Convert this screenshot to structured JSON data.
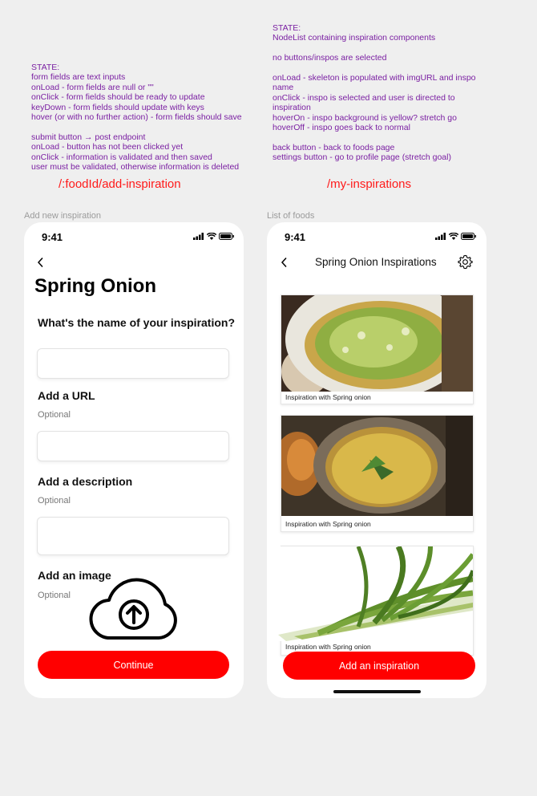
{
  "notes": {
    "left": "STATE:\nform fields are text inputs\nonLoad - form fields are null or \"\"\nonClick - form fields should be ready to update\nkeyDown - form fields should update with keys\nhover (or with no further action) - form fields should save\n\nsubmit button → post endpoint\nonLoad - button has not been clicked yet\nonClick - information is validated and then saved\nuser must be validated, otherwise information is deleted",
    "right": "STATE:\nNodeList containing inspiration components\n\nno buttons/inspos are selected\n\nonLoad - skeleton is populated with imgURL and inspo\nname\nonClick -  inspo is selected and user is directed to\ninspiration\nhoverOn - inspo background is yellow? stretch go\nhoverOff - inspo goes back to normal\n\nback button - back to foods page\nsettings button - go to profile page (stretch goal)"
  },
  "routes": {
    "left": "/:foodId/add-inspiration",
    "right": "/my-inspirations"
  },
  "frames": {
    "left_label": "Add new inspiration",
    "right_label": "List of foods"
  },
  "add_screen": {
    "time": "9:41",
    "title": "Spring Onion",
    "name_question": "What's the name of your inspiration?",
    "url_label": "Add a URL",
    "url_optional": "Optional",
    "desc_label": "Add a description",
    "desc_optional": "Optional",
    "image_label": "Add an image",
    "image_optional": "Optional",
    "continue_label": "Continue",
    "upload_icon": "cloud-upload-icon"
  },
  "list_screen": {
    "time": "9:41",
    "title": "Spring Onion Inspirations",
    "settings_icon": "gear-icon",
    "cards": [
      {
        "caption": "Inspiration with Spring onion"
      },
      {
        "caption": "Inspiration with Spring onion"
      },
      {
        "caption": "Inspiration with Spring onion"
      }
    ],
    "add_label": "Add an inspiration"
  },
  "colors": {
    "accent": "#ff0000",
    "note_text": "#7a1fa2",
    "route_text": "#ff1a1a"
  }
}
